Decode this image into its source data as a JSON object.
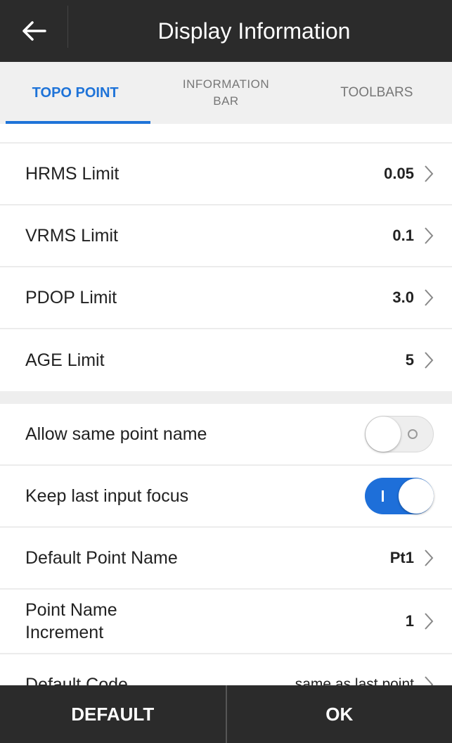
{
  "header": {
    "title": "Display Information",
    "back_icon": "arrow-left-icon"
  },
  "tabs": [
    {
      "label": "TOPO POINT",
      "active": true
    },
    {
      "label": "INFORMATION BAR",
      "line1": "INFORMATION",
      "line2": "BAR",
      "active": false
    },
    {
      "label": "TOOLBARS",
      "active": false
    }
  ],
  "limits": [
    {
      "label": "HRMS Limit",
      "value": "0.05"
    },
    {
      "label": "VRMS Limit",
      "value": "0.1"
    },
    {
      "label": "PDOP Limit",
      "value": "3.0"
    },
    {
      "label": "AGE Limit",
      "value": "5"
    }
  ],
  "settings": {
    "allow_same_point_name": {
      "label": "Allow same point name",
      "on": false
    },
    "keep_last_input_focus": {
      "label": "Keep last input focus",
      "on": true
    },
    "default_point_name": {
      "label": "Default Point Name",
      "value": "Pt1"
    },
    "point_name_increment": {
      "label_line1": "Point Name",
      "label_line2": "Increment",
      "value": "1"
    },
    "default_code": {
      "label": "Default Code",
      "value": "same as last point"
    }
  },
  "footer": {
    "default_label": "DEFAULT",
    "ok_label": "OK"
  },
  "colors": {
    "accent": "#1e73d8",
    "header_bg": "#2b2b2b",
    "tab_bg": "#f0f0f0"
  }
}
